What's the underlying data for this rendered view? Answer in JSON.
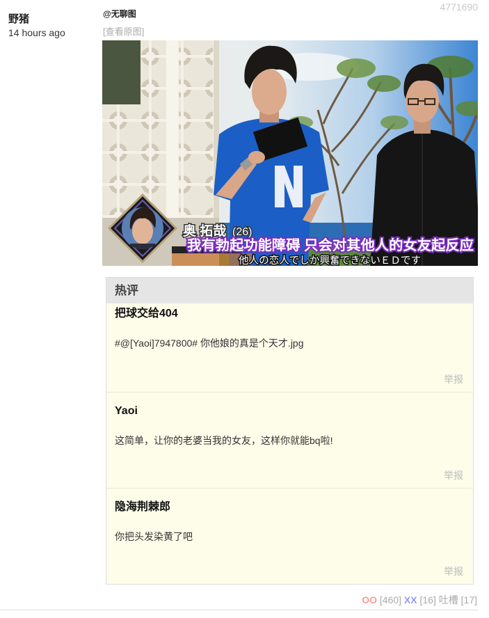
{
  "post": {
    "author": "野猪",
    "time": "14 hours ago",
    "id": "4771690",
    "category": "@无聊图",
    "view_original": "[查看原图]",
    "image": {
      "caption_name": "奥 拓哉",
      "caption_age": "(26)",
      "subtitle_cn": "我有勃起功能障碍 只会对其他人的女友起反应",
      "subtitle_jp": "他人の恋人でしか興奮できないＥＤです"
    }
  },
  "hot_comments": {
    "title": "热评",
    "items": [
      {
        "author": "把球交给404",
        "text": "#@[Yaoi]7947800# 你他娘的真是个天才.jpg",
        "report": "举报"
      },
      {
        "author": "Yaoi",
        "text": "这简单，让你的老婆当我的女友，这样你就能bq啦!",
        "report": "举报"
      },
      {
        "author": "隐海荆棘郎",
        "text": "你把头发染黄了吧",
        "report": "举报"
      }
    ]
  },
  "votes": {
    "oo_label": "OO",
    "oo_count": "[460]",
    "xx_label": "XX",
    "xx_count": "[16]",
    "tucao_label": "吐槽",
    "tucao_count": "[17]"
  },
  "colors": {
    "oo": "#ff9999",
    "xx": "#9999ff",
    "comment_bg": "#fdfdea",
    "header_bg": "#e5e5e5",
    "muted": "#aaaaaa"
  }
}
